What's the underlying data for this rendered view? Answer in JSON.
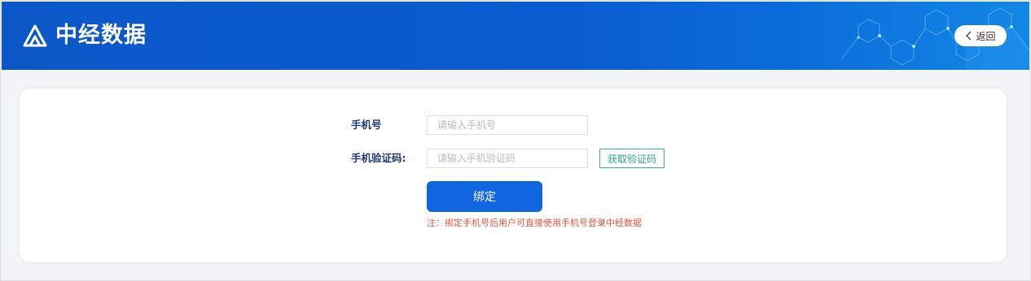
{
  "header": {
    "brand_name": "中经数据",
    "back_label": "返回",
    "colors": {
      "header_bg": "#0b57c8",
      "accent": "#0f66e0"
    }
  },
  "form": {
    "phone": {
      "label": "手机号",
      "placeholder": "请输入手机号",
      "value": ""
    },
    "code": {
      "label": "手机验证码:",
      "placeholder": "请输入手机验证码",
      "value": "",
      "get_code_label": "获取验证码"
    },
    "submit_label": "绑定",
    "note": "注：绑定手机号后用户可直接使用手机号登录中经数据"
  },
  "icons": {
    "logo": "brand-logo-icon",
    "back": "chevron-left-icon"
  }
}
